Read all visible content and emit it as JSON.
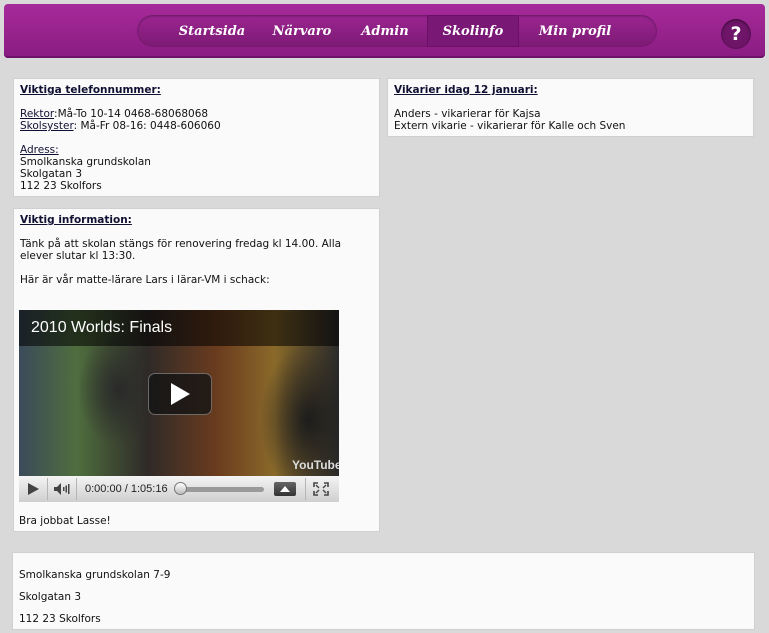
{
  "nav": {
    "items": [
      {
        "label": "Startsida",
        "active": false
      },
      {
        "label": "Närvaro",
        "active": false
      },
      {
        "label": "Admin",
        "active": false
      },
      {
        "label": "Skolinfo",
        "active": true
      },
      {
        "label": "Min profil",
        "active": false
      }
    ],
    "help_label": "?"
  },
  "phones": {
    "title": "Viktiga telefonnummer:",
    "rektor_label": "Rektor",
    "rektor_value": ":Må-To 10-14 0468-68068068",
    "skolsyster_label": "Skolsyster",
    "skolsyster_value": ": Må-Fr 08-16: 0448-606060",
    "address_label": "Adress:",
    "address_lines": [
      "Smolkanska grundskolan",
      "Skolgatan 3",
      "112 23 Skolfors"
    ]
  },
  "info": {
    "title": "Viktig information:",
    "text1": "Tänk på att skolan stängs för renovering fredag kl 14.00. Alla elever slutar kl 13:30.",
    "text2": "Här är vår matte-lärare Lars i lärar-VM i schack:",
    "footer": "Bra jobbat Lasse!"
  },
  "video": {
    "title": "2010 Worlds: Finals",
    "time": "0:00:00 / 1:05:16",
    "logo": "YouTube",
    "progress_fraction": 0.0,
    "icons": [
      "play-icon",
      "volume-icon",
      "quality-icon",
      "fullscreen-icon"
    ]
  },
  "substitutes": {
    "title": "Vikarier idag 12 januari:",
    "lines": [
      "Anders - vikarierar för Kajsa",
      "Extern vikarie - vikarierar för Kalle och Sven"
    ]
  },
  "footer": {
    "lines": [
      "Smolkanska grundskolan 7-9",
      "Skolgatan 3",
      "112 23 Skolfors"
    ]
  },
  "colors": {
    "brand": "#8a1c82",
    "background": "#d9d9d9",
    "box": "#fafafa"
  }
}
